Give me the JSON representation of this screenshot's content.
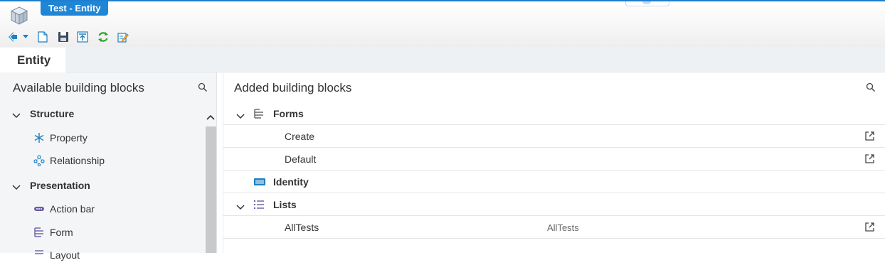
{
  "window": {
    "document_tab": "Test - Entity"
  },
  "toolbar": {
    "buttons": [
      {
        "icon": "navigate-back-icon"
      },
      {
        "icon": "dropdown-arrow-icon"
      },
      {
        "icon": "new-document-icon"
      },
      {
        "icon": "save-icon"
      },
      {
        "icon": "publish-icon"
      },
      {
        "icon": "refresh-icon"
      },
      {
        "icon": "edit-icon"
      }
    ]
  },
  "ribbon": {
    "tab": "Entity"
  },
  "left_panel": {
    "title": "Available building blocks",
    "groups": [
      {
        "label": "Structure",
        "items": [
          {
            "label": "Property",
            "icon": "property-asterisk-icon"
          },
          {
            "label": "Relationship",
            "icon": "relationship-nodes-icon"
          }
        ]
      },
      {
        "label": "Presentation",
        "items": [
          {
            "label": "Action bar",
            "icon": "action-bar-icon"
          },
          {
            "label": "Form",
            "icon": "form-icon"
          },
          {
            "label": "Layout",
            "icon": "layout-icon"
          }
        ]
      }
    ]
  },
  "right_panel": {
    "title": "Added building blocks",
    "rows": [
      {
        "kind": "group",
        "label": "Forms",
        "icon": "form-icon"
      },
      {
        "kind": "child",
        "label": "Create"
      },
      {
        "kind": "child",
        "label": "Default"
      },
      {
        "kind": "leaf",
        "label": "Identity",
        "icon": "identity-icon"
      },
      {
        "kind": "group",
        "label": "Lists",
        "icon": "list-icon"
      },
      {
        "kind": "child",
        "label": "AllTests",
        "detail": "AllTests"
      }
    ]
  },
  "colors": {
    "accent": "#1f86d6",
    "refresh": "#2aa52a",
    "icon_blue": "#1e7fc2",
    "icon_purple": "#6b5ba7",
    "panel_bg": "#f4f5f6"
  }
}
